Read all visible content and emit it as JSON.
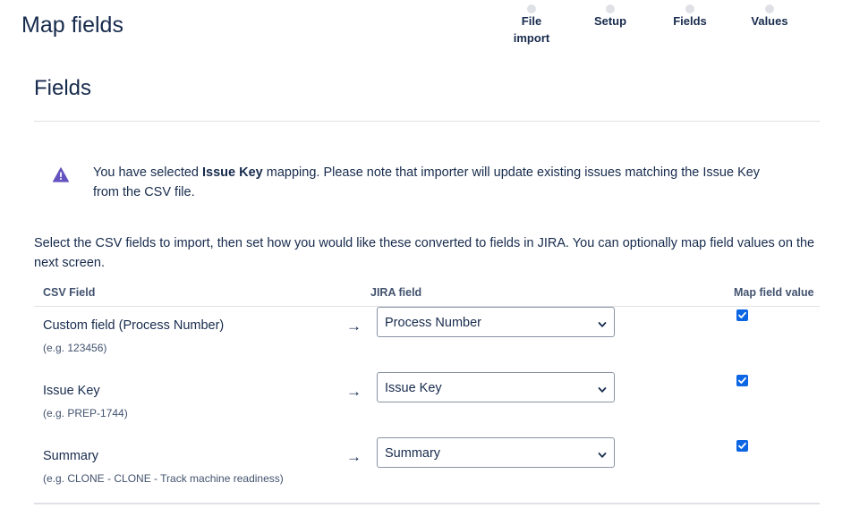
{
  "header": {
    "title": "Map fields",
    "steps": [
      {
        "label_line1": "File",
        "label_line2": "import"
      },
      {
        "label_line1": "Setup",
        "label_line2": ""
      },
      {
        "label_line1": "Fields",
        "label_line2": ""
      },
      {
        "label_line1": "Values",
        "label_line2": ""
      }
    ]
  },
  "section": {
    "title": "Fields"
  },
  "warning": {
    "icon": "warning-triangle-icon",
    "color": "#6554c0",
    "text_before": "You have selected ",
    "text_bold": "Issue Key",
    "text_after": " mapping. Please note that importer will update existing issues matching the Issue Key from the CSV file."
  },
  "intro_text": "Select the CSV fields to import, then set how you would like these converted to fields in JIRA. You can optionally map field values on the next screen.",
  "table": {
    "columns": {
      "csv_field": "CSV Field",
      "jira_field": "JIRA field",
      "map_value": "Map field value"
    },
    "arrow": "→",
    "rows": [
      {
        "csv_field": "Custom field (Process Number)",
        "example": "(e.g. 123456)",
        "jira_field": "Process Number",
        "map_value_checked": true
      },
      {
        "csv_field": "Issue Key",
        "example": "(e.g. PREP-1744)",
        "jira_field": "Issue Key",
        "map_value_checked": true
      },
      {
        "csv_field": "Summary",
        "example": "(e.g. CLONE - CLONE - Track machine readiness)",
        "jira_field": "Summary",
        "map_value_checked": true
      }
    ]
  },
  "colors": {
    "accent": "#0c66e4",
    "text": "#172b4d",
    "warning_icon": "#6554c0"
  }
}
